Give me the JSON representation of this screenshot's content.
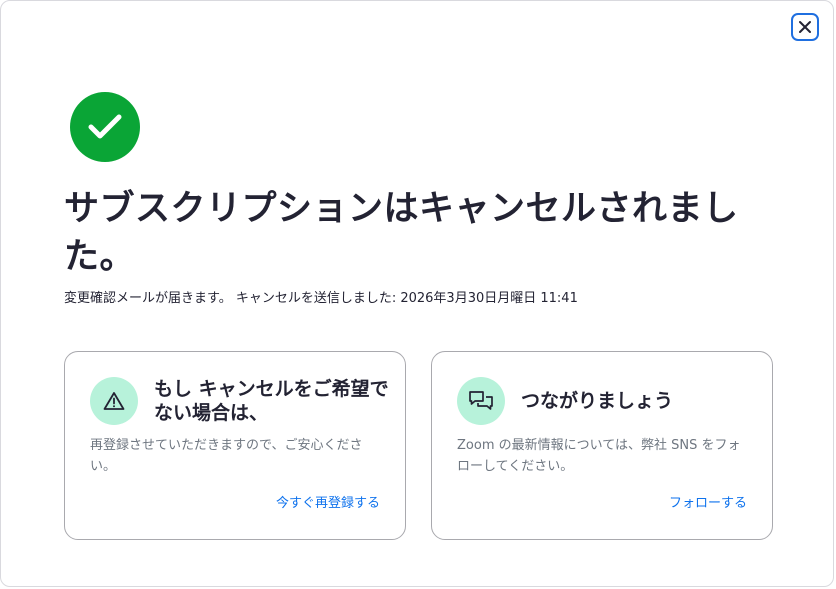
{
  "dialog": {
    "close_label": "Close",
    "title": "サブスクリプションはキャンセルされました。",
    "subtitle": "変更確認メールが届きます。 キャンセルを送信しました: 2026年3月30日月曜日 11:41"
  },
  "cards": [
    {
      "icon": "warning-icon",
      "title": "もし キャンセルをご希望でない場合は、",
      "description": "再登録させていただきますので、ご安心ください。",
      "link": "今すぐ再登録する"
    },
    {
      "icon": "chat-bubbles-icon",
      "title": "つながりましょう",
      "description": "Zoom の最新情報については、弊社 SNS をフォローしてください。",
      "link": "フォローする"
    }
  ],
  "colors": {
    "success": "#0aa536",
    "card_icon_bg": "#b7f2da",
    "link": "#0e72ed",
    "focus_ring": "#1f6fe0"
  }
}
